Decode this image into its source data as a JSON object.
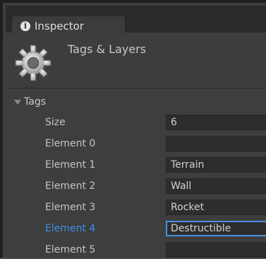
{
  "tab": {
    "label": "Inspector",
    "icon": "info-icon"
  },
  "header": {
    "title": "Tags & Layers",
    "icon": "gear-icon"
  },
  "tags": {
    "label": "Tags",
    "size_label": "Size",
    "size_value": "6",
    "elements": [
      {
        "label": "Element 0",
        "value": ""
      },
      {
        "label": "Element 1",
        "value": "Terrain"
      },
      {
        "label": "Element 2",
        "value": "Wall"
      },
      {
        "label": "Element 3",
        "value": "Rocket"
      },
      {
        "label": "Element 4",
        "value": "Destructible"
      },
      {
        "label": "Element 5",
        "value": ""
      }
    ]
  },
  "colors": {
    "active_label": "#3d8fe8",
    "active_border": "#4a90e2",
    "field_bg": "#2d2d2d"
  }
}
